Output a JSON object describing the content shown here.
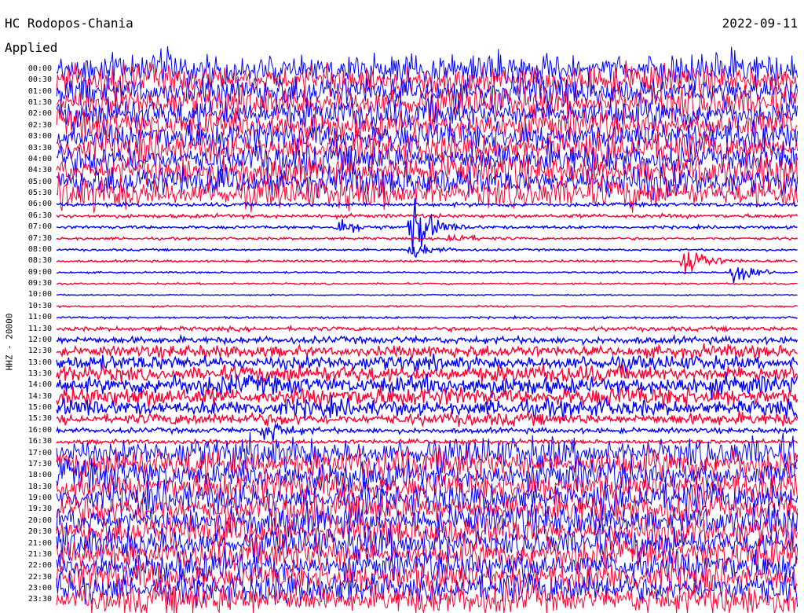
{
  "header": {
    "station": "HC Rodopos-Chania",
    "date": "2022-09-11",
    "filter": "Applied"
  },
  "chart_data": {
    "type": "line",
    "ylabel": "HHZ - 20000",
    "time_labels": [
      "00:00",
      "00:30",
      "01:00",
      "01:30",
      "02:00",
      "02:30",
      "03:00",
      "03:30",
      "04:00",
      "04:30",
      "05:00",
      "05:30",
      "06:00",
      "06:30",
      "07:00",
      "07:30",
      "08:00",
      "08:30",
      "09:00",
      "09:30",
      "10:00",
      "10:30",
      "11:00",
      "11:30",
      "12:00",
      "12:30",
      "13:00",
      "13:30",
      "14:00",
      "14:30",
      "15:00",
      "15:30",
      "16:00",
      "16:30",
      "17:00",
      "17:30",
      "18:00",
      "18:30",
      "19:00",
      "19:30",
      "20:00",
      "20:30",
      "21:00",
      "21:30",
      "22:00",
      "22:30",
      "23:00",
      "23:30"
    ],
    "trace_colors": [
      "#0000ff",
      "#ff0033"
    ],
    "line_amplitude": [
      5,
      5,
      5,
      5,
      5,
      5,
      5,
      5,
      5,
      5,
      5,
      5,
      0.9,
      0.9,
      0.7,
      0.6,
      0.5,
      0.5,
      0.4,
      0.4,
      0.3,
      0.4,
      0.5,
      1.0,
      1.6,
      2.5,
      3.0,
      3.5,
      4.0,
      4.0,
      3.5,
      2.5,
      1.2,
      1.0,
      5,
      5,
      5,
      5,
      5,
      5,
      5,
      5,
      5,
      5,
      5,
      5,
      5,
      5
    ],
    "events": [
      {
        "time": "07:00",
        "minute": 14.5,
        "size": 7
      },
      {
        "time": "07:00",
        "minute": 11.5,
        "size": 2
      },
      {
        "time": "07:30",
        "minute": 16,
        "size": 1.5
      },
      {
        "time": "08:30",
        "minute": 25.5,
        "size": 5
      },
      {
        "time": "09:00",
        "minute": 27.5,
        "size": 3.5
      },
      {
        "time": "08:00",
        "minute": 14.5,
        "size": 2
      },
      {
        "time": "16:00",
        "minute": 8.5,
        "size": 3
      }
    ]
  }
}
